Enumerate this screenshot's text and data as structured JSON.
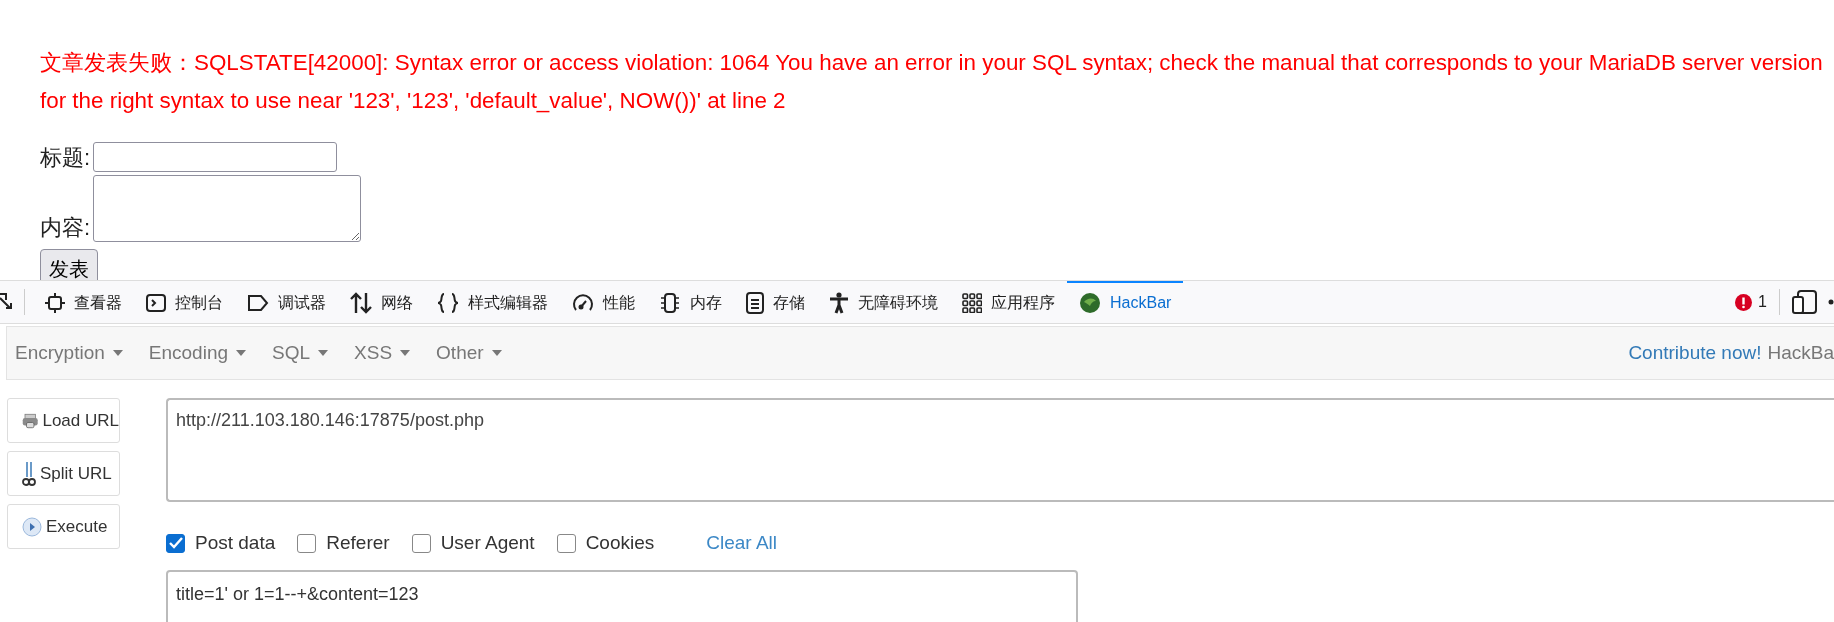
{
  "page": {
    "error_message": "文章发表失败：SQLSTATE[42000]: Syntax error or access violation: 1064 You have an error in your SQL syntax; check the manual that corresponds to your MariaDB server version for the right syntax to use near '123', '123', 'default_value', NOW())' at line 2",
    "form": {
      "fields": [
        {
          "label": "标题:",
          "kind": "input"
        },
        {
          "label": "内容:",
          "kind": "textarea"
        }
      ],
      "submit": "发表"
    }
  },
  "devtools": {
    "tabs": [
      {
        "label": "查看器",
        "selected": false
      },
      {
        "label": "控制台",
        "selected": false
      },
      {
        "label": "调试器",
        "selected": false
      },
      {
        "label": "网络",
        "selected": false
      },
      {
        "label": "样式编辑器",
        "selected": false
      },
      {
        "label": "性能",
        "selected": false
      },
      {
        "label": "内存",
        "selected": false
      },
      {
        "label": "存储",
        "selected": false
      },
      {
        "label": "无障碍环境",
        "selected": false
      },
      {
        "label": "应用程序",
        "selected": false
      },
      {
        "label": "HackBar",
        "selected": true
      }
    ],
    "error_count": "1"
  },
  "hackbar": {
    "menus": [
      "Encryption",
      "Encoding",
      "SQL",
      "XSS",
      "Other"
    ],
    "contribute_link": "Contribute now!",
    "brand": "HackBa",
    "actions": [
      {
        "label": "Load URL",
        "kind": "load"
      },
      {
        "label": "Split URL",
        "kind": "split"
      },
      {
        "label": "Execute",
        "kind": "execute"
      }
    ],
    "url": "http://211.103.180.146:17875/post.php",
    "options": [
      {
        "label": "Post data",
        "checked": true
      },
      {
        "label": "Referer",
        "checked": false
      },
      {
        "label": "User Agent",
        "checked": false
      },
      {
        "label": "Cookies",
        "checked": false
      }
    ],
    "clear_all": "Clear All",
    "post_data": "title=1' or 1=1--+&content=123"
  }
}
